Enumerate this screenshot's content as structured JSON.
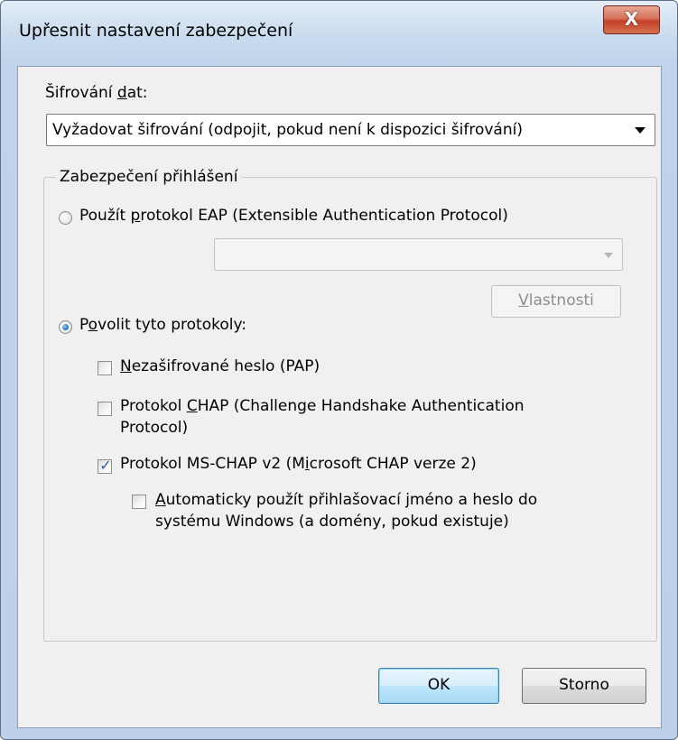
{
  "window": {
    "title": "Upřesnit nastavení zabezpečení",
    "close_glyph": "X",
    "close_icon": "close-icon"
  },
  "encryption": {
    "label": "Šifrování dat:",
    "label_mnemonic": "d",
    "selected_value": "Vyžadovat šifrování (odpojit, pokud není k dispozici šifrování)"
  },
  "logon_security": {
    "group_title": "Zabezpečení přihlášení",
    "eap_option": {
      "label": "Použít protokol EAP (Extensible Authentication Protocol)",
      "checked": false
    },
    "eap_combo_value": "",
    "properties_button": "Vlastnosti",
    "allow_option": {
      "label": "Povolit tyto protokoly:",
      "checked": true
    },
    "protocols": [
      {
        "label": "Nezašifrované heslo (PAP)",
        "checked": false
      },
      {
        "label_line1": "Protokol CHAP (Challenge Handshake Authentication",
        "label_line2": "Protocol)",
        "checked": false
      },
      {
        "label": "Protokol MS-CHAP v2 (Microsoft CHAP verze 2)",
        "checked": true
      }
    ],
    "auto_logon": {
      "label_line1": "Automaticky použít přihlašovací jméno a heslo do",
      "label_line2": "systému Windows (a domény, pokud existuje)",
      "checked": false
    }
  },
  "buttons": {
    "ok": "OK",
    "cancel": "Storno"
  },
  "colors": {
    "accent": "#2a7bc8",
    "close_button": "#c2412a",
    "checkmark": "#2d5fa7"
  }
}
